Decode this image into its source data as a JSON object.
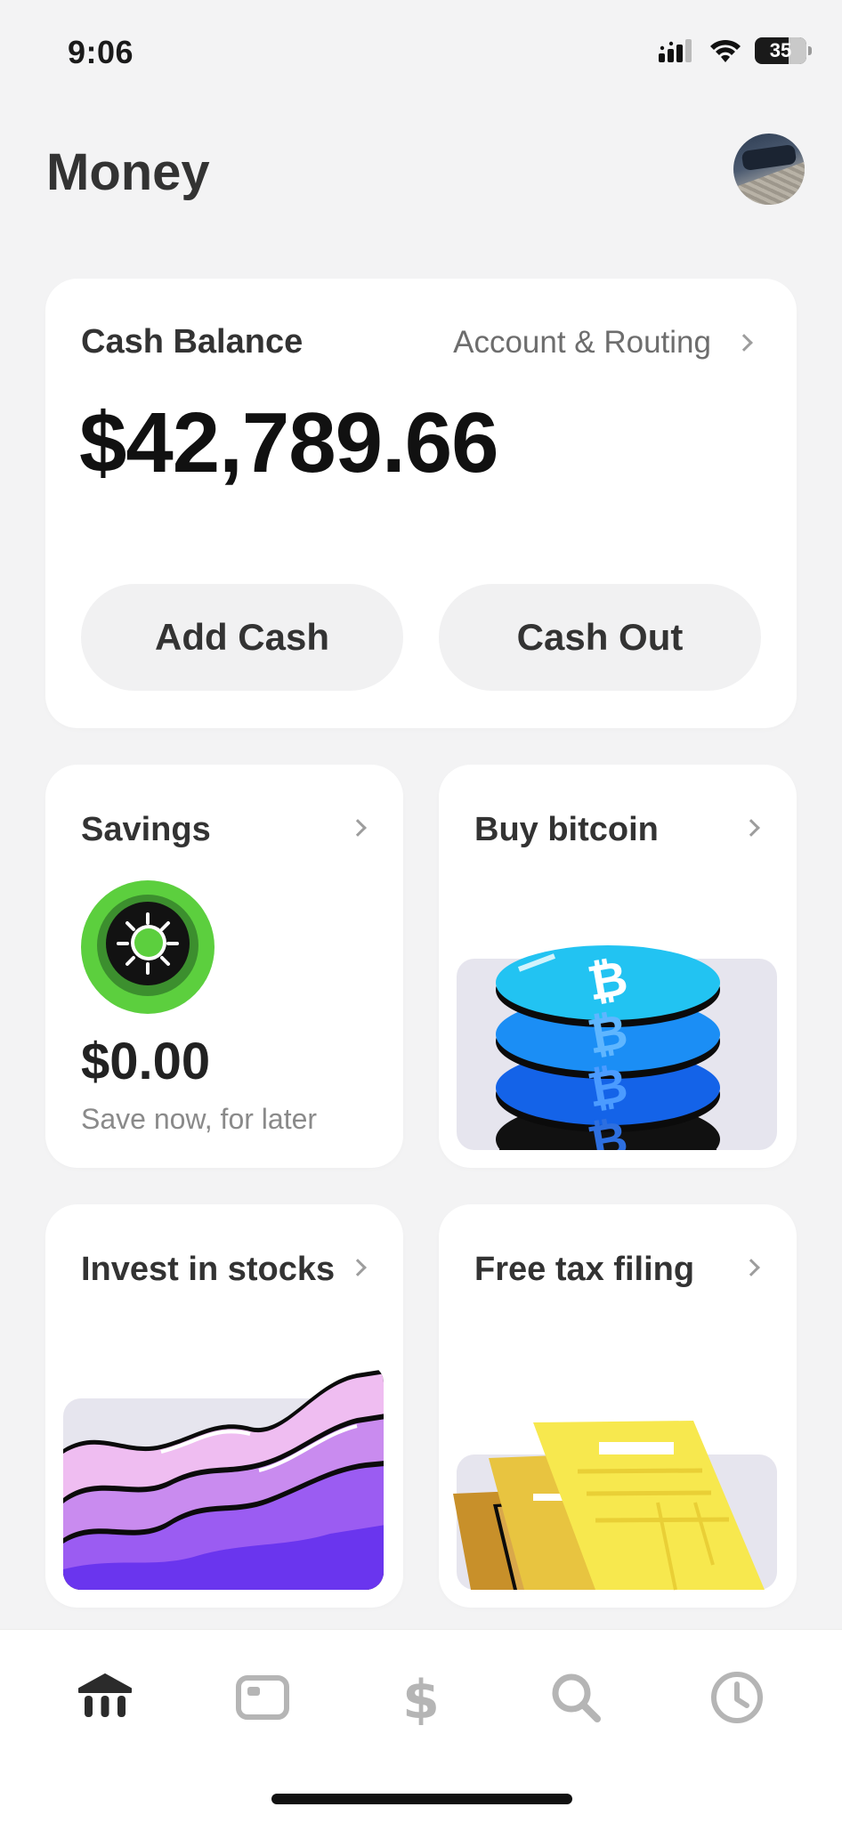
{
  "status": {
    "time": "9:06",
    "battery": "35"
  },
  "header": {
    "title": "Money"
  },
  "cash_balance": {
    "label": "Cash Balance",
    "routing_link": "Account & Routing",
    "amount": "$42,789.66",
    "add_cash": "Add Cash",
    "cash_out": "Cash Out"
  },
  "tiles": {
    "savings": {
      "title": "Savings",
      "amount": "$0.00",
      "subtitle": "Save now, for later"
    },
    "bitcoin": {
      "title": "Buy bitcoin"
    },
    "stocks": {
      "title": "Invest in stocks"
    },
    "tax": {
      "title": "Free tax filing"
    }
  },
  "tab_bar": {
    "tabs": [
      {
        "icon": "bank-icon",
        "active": true
      },
      {
        "icon": "card-icon",
        "active": false
      },
      {
        "icon": "dollar-icon",
        "active": false
      },
      {
        "icon": "search-icon",
        "active": false
      },
      {
        "icon": "clock-icon",
        "active": false
      }
    ]
  },
  "colors": {
    "background": "#f3f3f4",
    "card": "#ffffff",
    "savings_green": "#5ccf3e",
    "bitcoin_blue": "#1aa7f0",
    "stocks_purple": "#7b3ff0",
    "tax_yellow": "#f6e54e"
  }
}
